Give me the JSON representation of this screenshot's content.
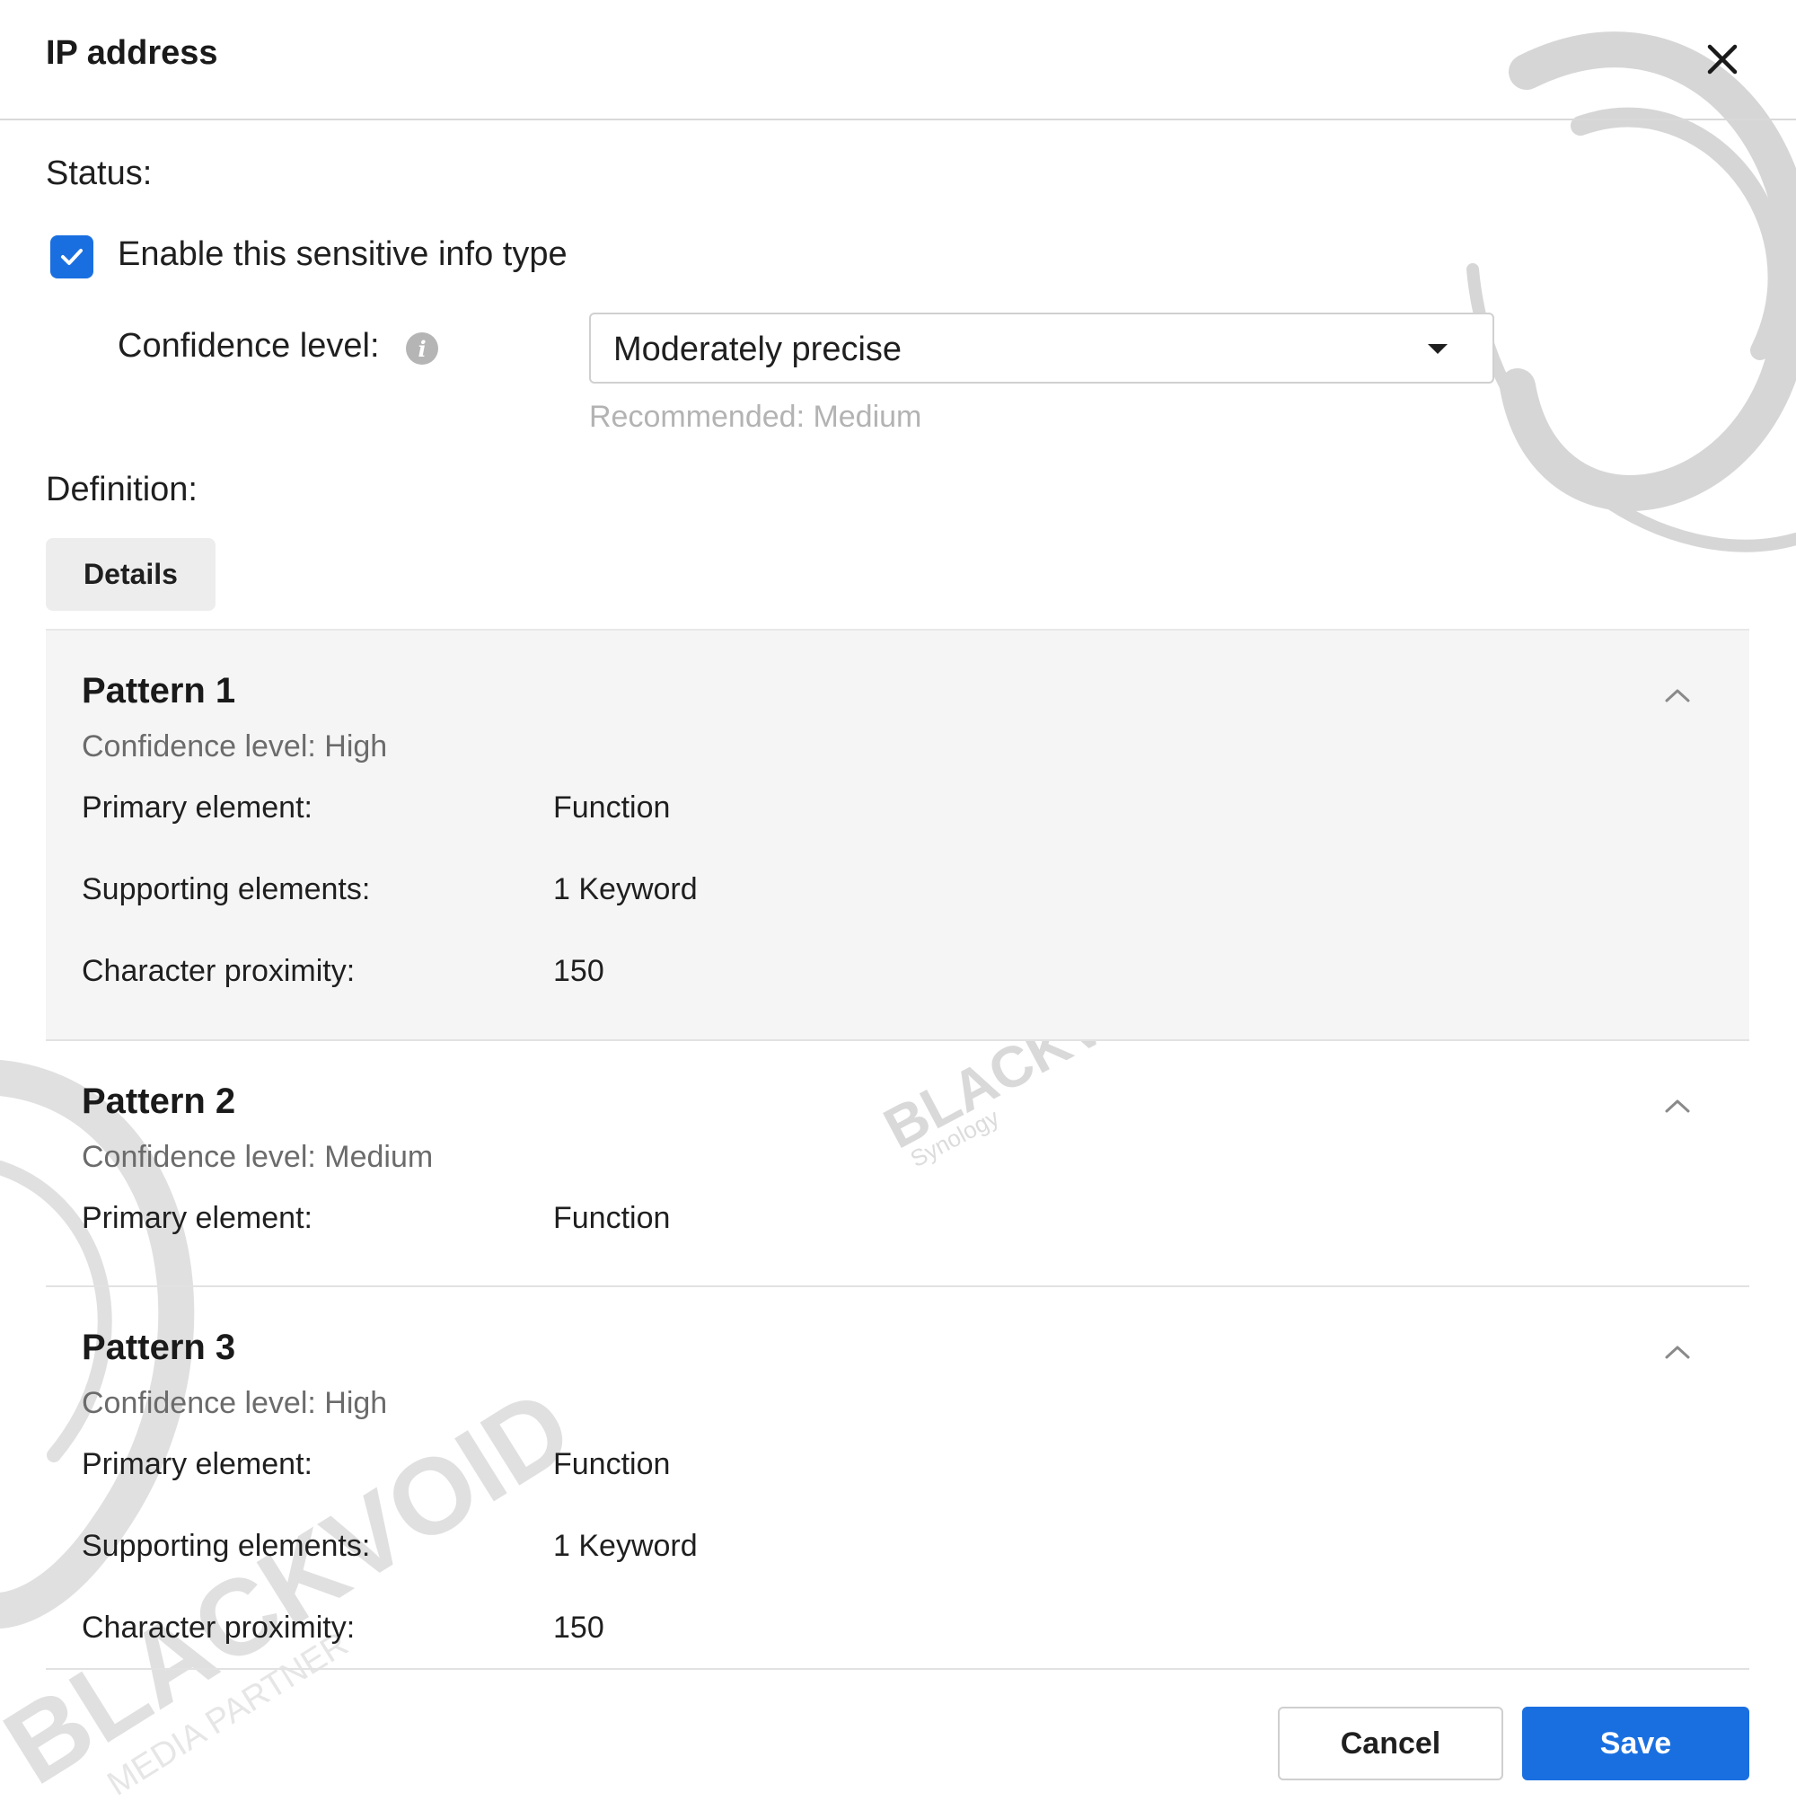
{
  "dialog": {
    "title": "IP address"
  },
  "status": {
    "label": "Status:",
    "checkbox_label": "Enable this sensitive info type",
    "checkbox_checked": true,
    "confidence_label": "Confidence level:",
    "confidence_value": "Moderately precise",
    "recommended_hint": "Recommended: Medium"
  },
  "definition": {
    "label": "Definition:",
    "details_button": "Details"
  },
  "patterns": [
    {
      "title": "Pattern 1",
      "confidence": "Confidence level: High",
      "rows": [
        {
          "label": "Primary element:",
          "value": "Function"
        },
        {
          "label": "Supporting elements:",
          "value": "1 Keyword"
        },
        {
          "label": "Character proximity:",
          "value": "150"
        }
      ]
    },
    {
      "title": "Pattern 2",
      "confidence": "Confidence level: Medium",
      "rows": [
        {
          "label": "Primary element:",
          "value": "Function"
        }
      ]
    },
    {
      "title": "Pattern 3",
      "confidence": "Confidence level: High",
      "rows": [
        {
          "label": "Primary element:",
          "value": "Function"
        },
        {
          "label": "Supporting elements:",
          "value": "1 Keyword"
        },
        {
          "label": "Character proximity:",
          "value": "150"
        }
      ]
    }
  ],
  "footer": {
    "cancel_label": "Cancel",
    "save_label": "Save"
  },
  "watermark": {
    "brand": "BLACKVOID",
    "sub": "Synology",
    "partner": "MEDIA PARTNER"
  },
  "colors": {
    "accent": "#1a6fe0",
    "pattern1_bg": "#f5f5f5",
    "hint_text": "#b3b3b3",
    "muted_text": "#6b6b6b"
  },
  "icons": {
    "close": "close-icon",
    "check": "checkmark-icon",
    "info": "info-icon",
    "dropdown": "caret-down-icon",
    "collapse": "chevron-up-icon"
  }
}
